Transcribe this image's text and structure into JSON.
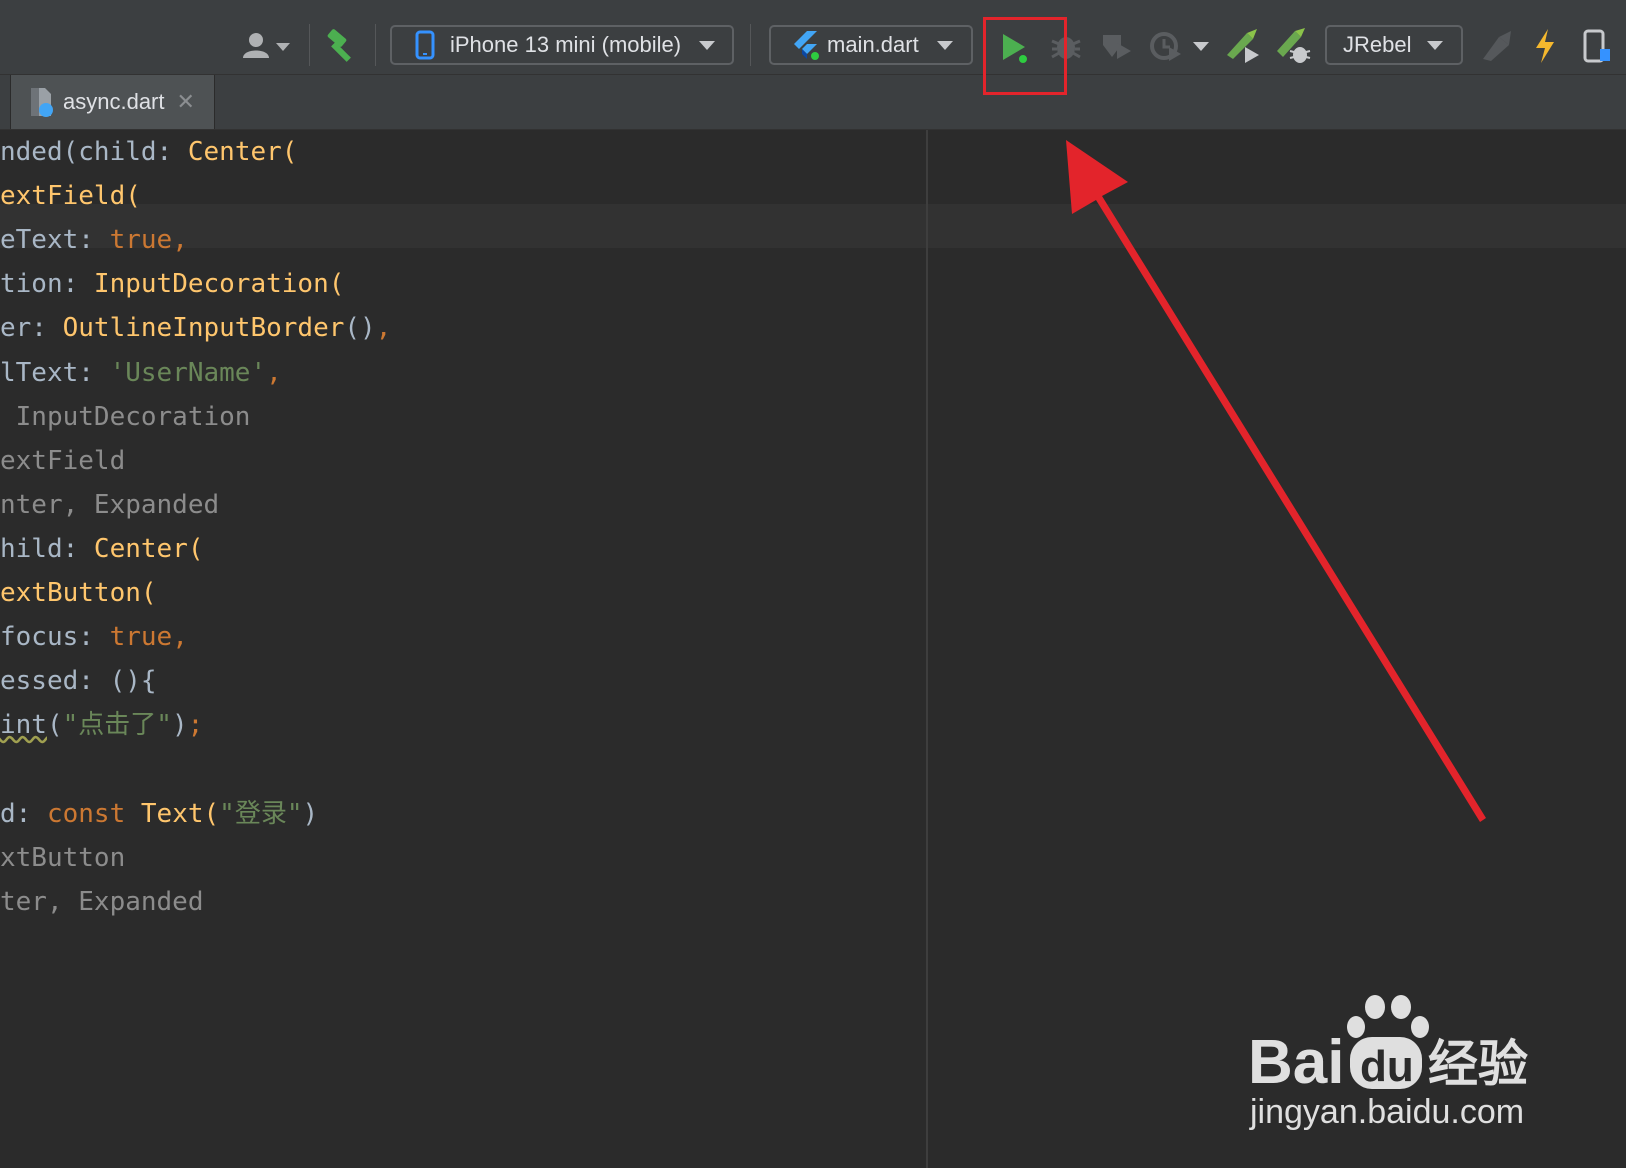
{
  "toolbar": {
    "device_selector": "iPhone 13 mini (mobile)",
    "run_config": "main.dart",
    "jrebel_selector": "JRebel"
  },
  "tabs": [
    {
      "label": "async.dart",
      "close": "✕"
    }
  ],
  "code_lines": [
    [
      {
        "t": "nded(",
        "c": "c-name"
      },
      {
        "t": "child: ",
        "c": "c-name"
      },
      {
        "t": "Center(",
        "c": "c-fn"
      }
    ],
    [
      {
        "t": "extField(",
        "c": "c-fn"
      }
    ],
    [
      {
        "t": "eText: ",
        "c": "c-name"
      },
      {
        "t": "true,",
        "c": "c-kw"
      }
    ],
    [
      {
        "t": "tion: ",
        "c": "c-name"
      },
      {
        "t": "InputDecoration(",
        "c": "c-fn"
      }
    ],
    [
      {
        "t": "er: ",
        "c": "c-name"
      },
      {
        "t": "OutlineInputBorder",
        "c": "c-fn"
      },
      {
        "t": "()",
        "c": "c-name"
      },
      {
        "t": ",",
        "c": "c-kw"
      }
    ],
    [
      {
        "t": "lText: ",
        "c": "c-name"
      },
      {
        "t": "'UserName'",
        "c": "c-str"
      },
      {
        "t": ",",
        "c": "c-kw"
      }
    ],
    [
      {
        "t": " InputDecoration",
        "c": "c-hint"
      }
    ],
    [
      {
        "t": "extField",
        "c": "c-hint"
      }
    ],
    [
      {
        "t": "nter, Expanded",
        "c": "c-hint"
      }
    ],
    [
      {
        "t": "hild: ",
        "c": "c-name"
      },
      {
        "t": "Center(",
        "c": "c-fn"
      }
    ],
    [
      {
        "t": "extButton(",
        "c": "c-fn"
      }
    ],
    [
      {
        "t": "focus: ",
        "c": "c-name"
      },
      {
        "t": "true,",
        "c": "c-kw"
      }
    ],
    [
      {
        "t": "essed: (){",
        "c": "c-name"
      }
    ],
    [
      {
        "t": "int",
        "c": "c-name squig"
      },
      {
        "t": "(",
        "c": "c-name"
      },
      {
        "t": "\"点击了\"",
        "c": "c-str"
      },
      {
        "t": ")",
        "c": "c-name"
      },
      {
        "t": ";",
        "c": "c-kw"
      }
    ],
    [],
    [
      {
        "t": "d: ",
        "c": "c-name"
      },
      {
        "t": "const ",
        "c": "c-kw"
      },
      {
        "t": "Text(",
        "c": "c-fn"
      },
      {
        "t": "\"登录\"",
        "c": "c-str"
      },
      {
        "t": ")",
        "c": "c-name"
      }
    ],
    [
      {
        "t": "xtButton",
        "c": "c-hint"
      }
    ],
    [
      {
        "t": "ter, Expanded",
        "c": "c-hint"
      }
    ]
  ],
  "watermark": {
    "brand": "Bai",
    "brand_du": "du",
    "suffix": "经验",
    "url": "jingyan.baidu.com"
  },
  "colors": {
    "run_green": "#4caf50",
    "annotation_red": "#e3242b",
    "flutter_blue": "#42a5f5"
  }
}
